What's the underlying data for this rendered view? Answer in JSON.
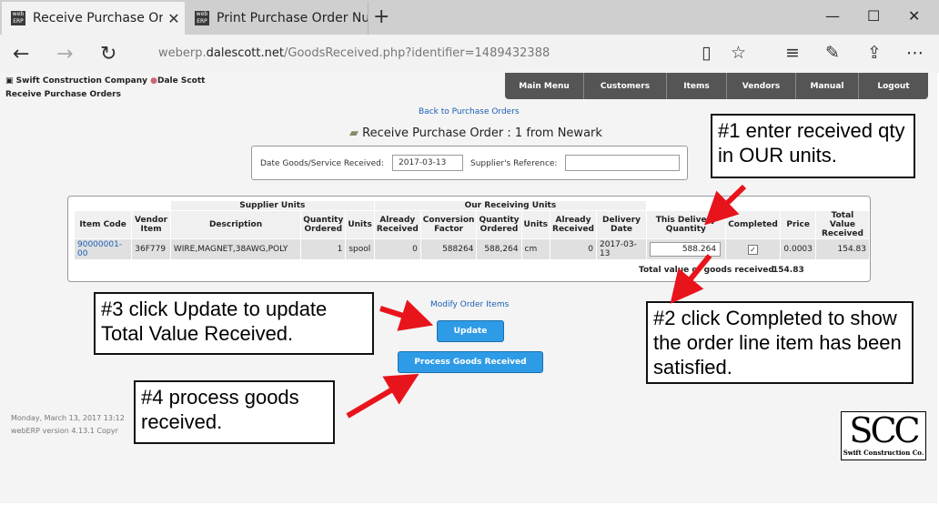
{
  "browser": {
    "tabs": [
      {
        "title": "Receive Purchase Order",
        "active": true
      },
      {
        "title": "Print Purchase Order Numb",
        "active": false
      }
    ],
    "favicon_text": "web ERP",
    "new_tab_icon": "+",
    "url_prefix": "weberp.",
    "url_domain": "dalescott.net",
    "url_path": "/GoodsReceived.php?identifier=1489432388"
  },
  "header": {
    "company": "Swift Construction Company",
    "user": "Dale Scott",
    "breadcrumb": "Receive Purchase Orders",
    "menu": [
      "Main Menu",
      "Customers",
      "Items",
      "Vendors",
      "Manual",
      "Logout"
    ]
  },
  "page": {
    "back_link": "Back to Purchase Orders",
    "title": "Receive Purchase Order : 1 from Newark",
    "date_label": "Date Goods/Service Received:",
    "date_value": "2017-03-13",
    "supplier_ref_label": "Supplier's Reference:",
    "supplier_ref_value": ""
  },
  "table": {
    "group_headers": {
      "supplier_units": "Supplier Units",
      "our_units": "Our Receiving Units"
    },
    "headers": [
      "Item Code",
      "Vendor Item",
      "Description",
      "Quantity Ordered",
      "Units",
      "Already Received",
      "Conversion Factor",
      "Quantity Ordered",
      "Units",
      "Already Received",
      "Delivery Date",
      "This Delivery Quantity",
      "Completed",
      "Price",
      "Total Value Received"
    ],
    "row": {
      "item_code": "90000001-00",
      "vendor_item": "36F779",
      "description": "WIRE,MAGNET,38AWG,POLY",
      "qty_ordered": "1",
      "units": "spool",
      "already_received": "0",
      "conversion_factor": "588264",
      "our_qty_ordered": "588,264",
      "our_units": "cm",
      "our_already_received": "0",
      "delivery_date": "2017-03-13",
      "this_delivery_qty": "588.264",
      "completed": true,
      "price": "0.0003",
      "total_value": "154.83"
    },
    "total_label": "Total value of goods received",
    "total_value": "154.83"
  },
  "actions": {
    "modify_link": "Modify Order Items",
    "update_label": "Update",
    "process_label": "Process Goods Received"
  },
  "footer": {
    "datetime": "Monday, March 13, 2017 13:12",
    "version": "webERP version 4.13.1 Copyr"
  },
  "callouts": {
    "c1": "#1 enter received qty in OUR units.",
    "c2": "#2 click Completed to show the order line item has been satisfied.",
    "c3": "#3 click Update to update Total Value Received.",
    "c4": "#4 process goods received."
  },
  "logo": {
    "big": "SCC",
    "small": "Swift Construction Co."
  },
  "colors": {
    "accent": "#2e9be6",
    "menubar": "#555555",
    "arrow": "#e8141c",
    "link": "#1a5fb4"
  }
}
